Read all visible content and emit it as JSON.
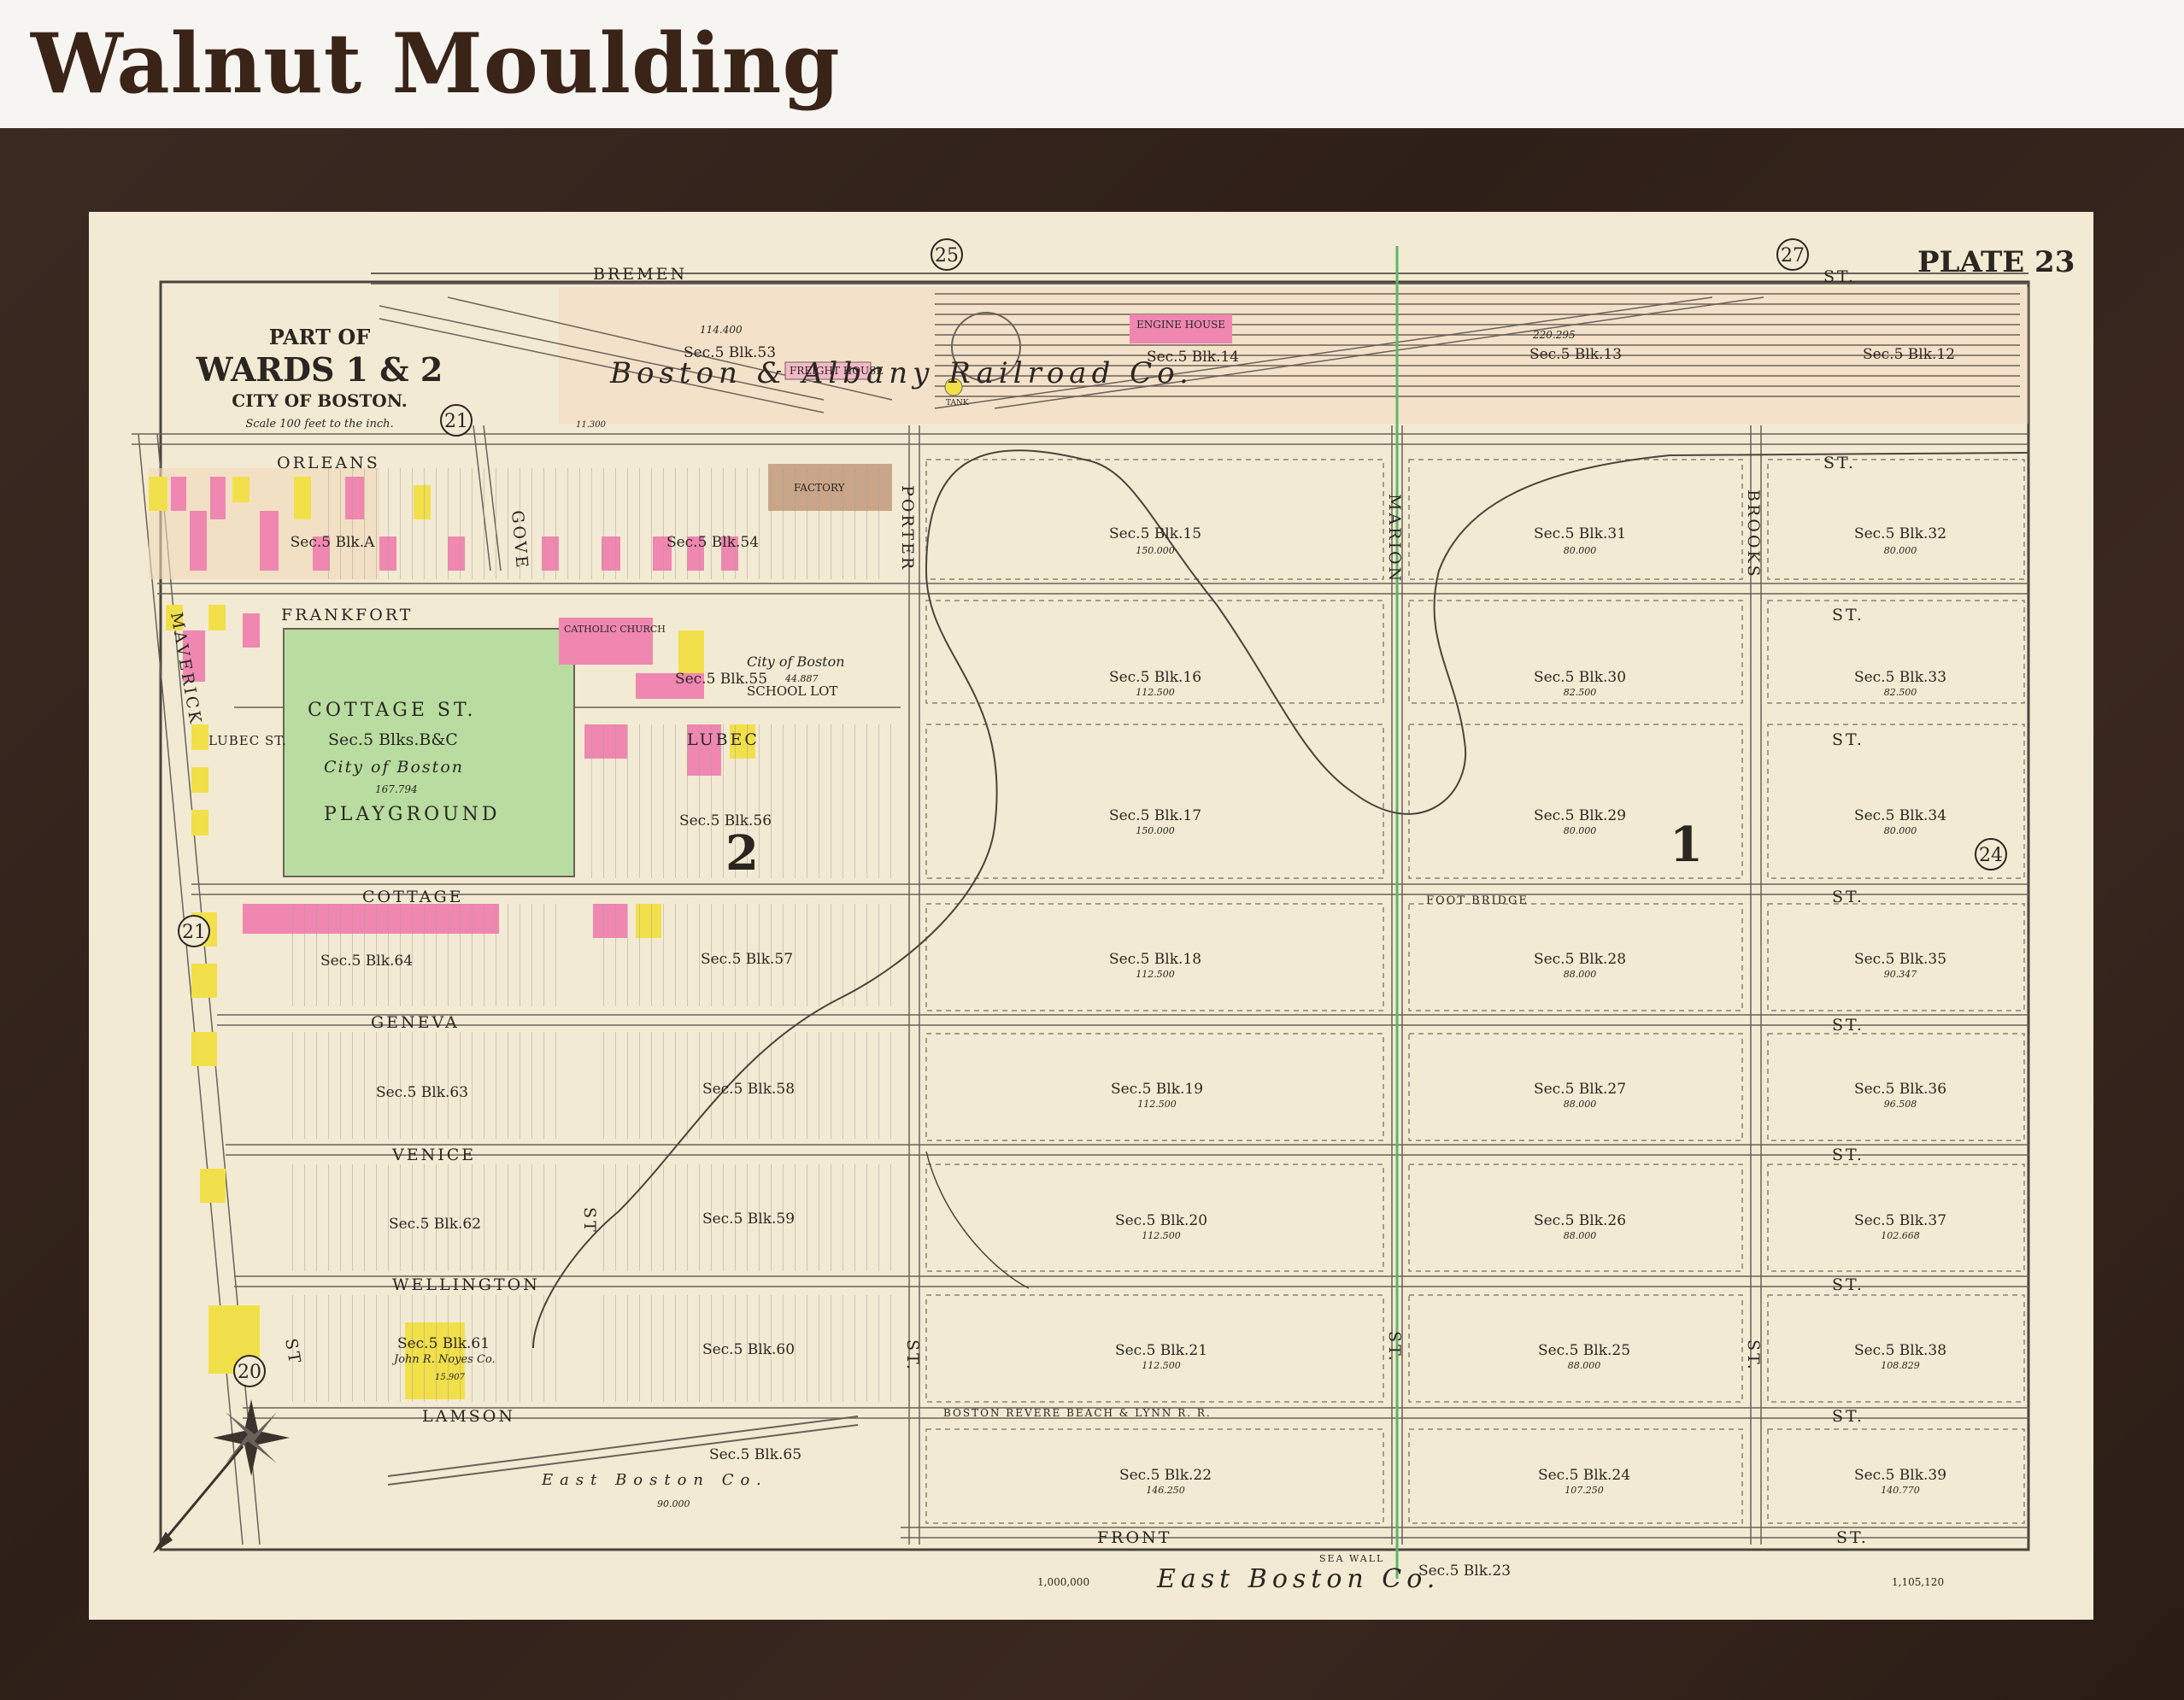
{
  "header": {
    "title": "Walnut Moulding"
  },
  "map": {
    "plate": "PLATE 23",
    "title_lines": [
      "PART OF",
      "WARDS 1 & 2",
      "CITY OF BOSTON."
    ],
    "scale": "Scale 100 feet to the inch.",
    "ward_numbers": [
      "25",
      "27",
      "21",
      "21",
      "20",
      "24"
    ],
    "big_numbers": [
      "1",
      "2"
    ],
    "streets": {
      "bremen": "BREMEN",
      "st_top": "ST.",
      "orleans": "ORLEANS",
      "frankfort": "FRANKFORT",
      "lubec_st": "LUBEC ST.",
      "lubec": "LUBEC",
      "cottage": "COTTAGE",
      "geneva": "GENEVA",
      "venice": "VENICE",
      "wellington": "WELLINGTON",
      "lamson": "LAMSON",
      "front": "FRONT",
      "maverick": "MAVERICK",
      "st_maverick": "ST",
      "gove": "GOVE",
      "porter": "PORTER",
      "marion": "MARION",
      "brooks": "BROOKS",
      "st_generic": "ST.",
      "st_short": "ST",
      "foot_bridge": "FOOT BRIDGE",
      "railroad": "BOSTON        REVERE BEACH        &        LYNN        R.    R.",
      "sea_wall": "SEA        WALL"
    },
    "buildings": {
      "engine_house": "ENGINE HOUSE",
      "freight_house": "FREIGHT HOUSE",
      "factory": "FACTORY",
      "catholic_church": "CATHOLIC CHURCH",
      "school_lot": "SCHOOL LOT",
      "tank": "TANK"
    },
    "areas": {
      "cottage_st": "COTTAGE  ST.",
      "blks_bc": "Sec.5 Blks.B&C",
      "city_of_boston": "City of Boston",
      "area_167": "167.794",
      "playground": "PLAYGROUND",
      "city_boston_school": "City of Boston",
      "area_44": "44.887",
      "railroad_co": "Boston   &   Albany   Railroad   Co.",
      "area_14400": "114.400",
      "area_220": "220.295",
      "area_11300": "11.300",
      "east_boston_co": "East   Boston   Co.",
      "east_boston_co_bottom": "East          Boston          Co.",
      "area_90": "90.000",
      "coord_left": "1,000,000",
      "coord_right": "1,105,120",
      "john_noyes": "John R. Noyes Co.",
      "area_15": "15.907"
    },
    "blocks": [
      {
        "label": "Sec.5 Blk.53",
        "area": ""
      },
      {
        "label": "Sec.5 Blk.14",
        "area": ""
      },
      {
        "label": "Sec.5 Blk.13",
        "area": ""
      },
      {
        "label": "Sec.5 Blk.12",
        "area": ""
      },
      {
        "label": "Sec.5 Blk.A",
        "area": ""
      },
      {
        "label": "Sec.5 Blk.54",
        "area": ""
      },
      {
        "label": "Sec.5 Blk.15",
        "area": "150.000"
      },
      {
        "label": "Sec.5 Blk.31",
        "area": "80.000"
      },
      {
        "label": "Sec.5 Blk.32",
        "area": "80.000"
      },
      {
        "label": "Sec.5 Blk.55",
        "area": ""
      },
      {
        "label": "Sec.5 Blk.16",
        "area": "112.500"
      },
      {
        "label": "Sec.5 Blk.30",
        "area": "82.500"
      },
      {
        "label": "Sec.5 Blk.33",
        "area": "82.500"
      },
      {
        "label": "Sec.5 Blk.56",
        "area": ""
      },
      {
        "label": "Sec.5 Blk.17",
        "area": "150.000"
      },
      {
        "label": "Sec.5 Blk.29",
        "area": "80.000"
      },
      {
        "label": "Sec.5 Blk.34",
        "area": "80.000"
      },
      {
        "label": "Sec.5 Blk.64",
        "area": ""
      },
      {
        "label": "Sec.5 Blk.57",
        "area": ""
      },
      {
        "label": "Sec.5 Blk.18",
        "area": "112.500"
      },
      {
        "label": "Sec.5 Blk.28",
        "area": "88.000"
      },
      {
        "label": "Sec.5 Blk.35",
        "area": "90.347"
      },
      {
        "label": "Sec.5 Blk.63",
        "area": ""
      },
      {
        "label": "Sec.5 Blk.58",
        "area": ""
      },
      {
        "label": "Sec.5 Blk.19",
        "area": "112.500"
      },
      {
        "label": "Sec.5 Blk.27",
        "area": "88.000"
      },
      {
        "label": "Sec.5 Blk.36",
        "area": "96.508"
      },
      {
        "label": "Sec.5 Blk.62",
        "area": ""
      },
      {
        "label": "Sec.5 Blk.59",
        "area": ""
      },
      {
        "label": "Sec.5 Blk.20",
        "area": "112.500"
      },
      {
        "label": "Sec.5 Blk.26",
        "area": "88.000"
      },
      {
        "label": "Sec.5 Blk.37",
        "area": "102.668"
      },
      {
        "label": "Sec.5 Blk.61",
        "area": ""
      },
      {
        "label": "Sec.5 Blk.60",
        "area": ""
      },
      {
        "label": "Sec.5 Blk.21",
        "area": "112.500"
      },
      {
        "label": "Sec.5 Blk.25",
        "area": "88.000"
      },
      {
        "label": "Sec.5 Blk.38",
        "area": "108.829"
      },
      {
        "label": "Sec.5 Blk.65",
        "area": ""
      },
      {
        "label": "Sec.5 Blk.22",
        "area": "146.250"
      },
      {
        "label": "Sec.5 Blk.24",
        "area": "107.250"
      },
      {
        "label": "Sec.5 Blk.39",
        "area": "140.770"
      },
      {
        "label": "Sec.5 Blk.23",
        "area": ""
      }
    ],
    "colors": {
      "paper": "#f3ead3",
      "pink": "#ef87b1",
      "yellow": "#f2e04a",
      "green": "#b9dda0",
      "brown": "#c9a689",
      "orange_wash": "#f2c9a0",
      "line": "#6a625a"
    }
  }
}
